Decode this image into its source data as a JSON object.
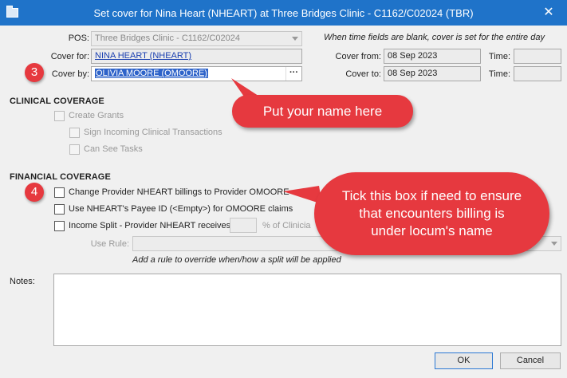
{
  "window": {
    "title": "Set cover for Nina Heart (NHEART) at Three Bridges Clinic - C1162/C02024 (TBR)",
    "close_glyph": "✕"
  },
  "form": {
    "pos_label": "POS:",
    "pos_value": "Three Bridges Clinic - C1162/C02024",
    "cover_for_label": "Cover for:",
    "cover_for_value": "NINA HEART (NHEART)",
    "cover_by_label": "Cover by:",
    "cover_by_value": "OLIVIA MOORE (OMOORE)",
    "cover_by_button": "···",
    "time_hint": "When time fields are blank, cover is set for the entire day",
    "cover_from_label": "Cover from:",
    "cover_from_value": "08 Sep 2023",
    "cover_to_label": "Cover to:",
    "cover_to_value": "08 Sep 2023",
    "time_from_label": "Time:",
    "time_from_value": "",
    "time_to_label": "Time:",
    "time_to_value": ""
  },
  "clinical": {
    "heading": "CLINICAL COVERAGE",
    "items": [
      {
        "label": "Create Grants",
        "checked": false,
        "disabled": true
      },
      {
        "label": "Sign Incoming Clinical Transactions",
        "checked": false,
        "disabled": true
      },
      {
        "label": "Can See Tasks",
        "checked": false,
        "disabled": true
      }
    ]
  },
  "financial": {
    "heading": "FINANCIAL COVERAGE",
    "items": [
      {
        "label": "Change Provider NHEART billings to Provider OMOORE",
        "checked": false
      },
      {
        "label": "Use NHEART's Payee ID (<Empty>) for OMOORE claims",
        "checked": false
      },
      {
        "label": "Income Split - Provider NHEART receives",
        "checked": false
      }
    ],
    "percent_value": "",
    "percent_suffix": "% of Clinicia",
    "use_rule_label": "Use Rule:",
    "use_rule_value": "",
    "rule_hint": "Add a rule to override when/how a split will be applied"
  },
  "notes": {
    "label": "Notes:",
    "value": ""
  },
  "buttons": {
    "ok": "OK",
    "cancel": "Cancel"
  },
  "annotations": {
    "badge_3": "3",
    "badge_4": "4",
    "callout_name": "Put your name here",
    "callout_tick": "Tick this box if need to ensure that encounters billing is under locum's name"
  },
  "colors": {
    "titlebar": "#1f73c9",
    "callout": "#e6393f",
    "selection": "#2e63c9"
  }
}
